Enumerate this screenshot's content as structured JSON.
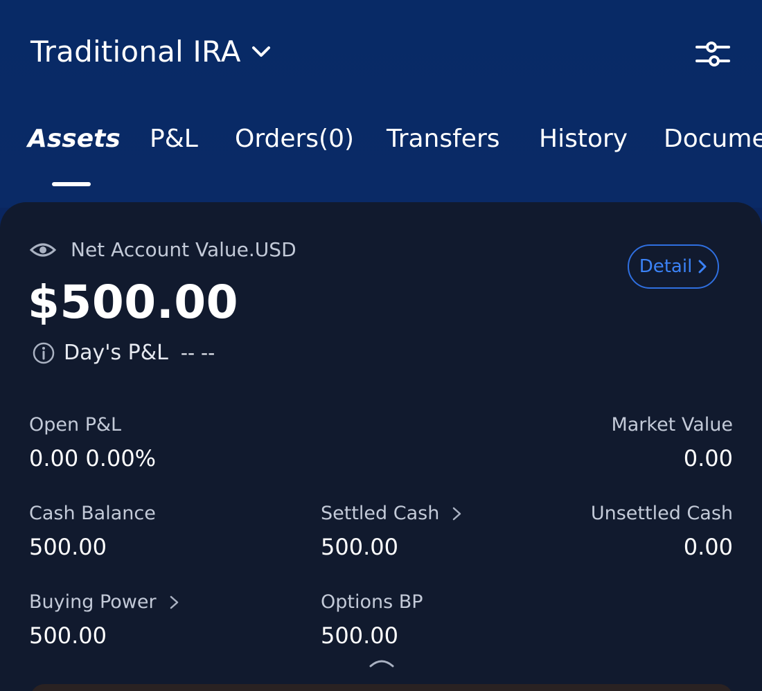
{
  "header": {
    "account_title": "Traditional IRA",
    "accent": "#0a2a66"
  },
  "tabs": [
    {
      "label": "Assets",
      "active": true
    },
    {
      "label": "P&L",
      "active": false
    },
    {
      "label": "Orders(0)",
      "active": false
    },
    {
      "label": "Transfers",
      "active": false
    },
    {
      "label": "History",
      "active": false
    },
    {
      "label": "Docume",
      "active": false
    }
  ],
  "summary": {
    "nav_label": "Net Account Value.USD",
    "nav_value": "$500.00",
    "detail_label": "Detail",
    "days_pl_label": "Day's P&L",
    "days_pl_value": "-- --"
  },
  "metrics": {
    "open_pl": {
      "label": "Open P&L",
      "value": "0.00 0.00%"
    },
    "market_value": {
      "label": "Market Value",
      "value": "0.00"
    },
    "cash_balance": {
      "label": "Cash Balance",
      "value": "500.00"
    },
    "settled_cash": {
      "label": "Settled Cash",
      "value": "500.00"
    },
    "unsettled_cash": {
      "label": "Unsettled Cash",
      "value": "0.00"
    },
    "buying_power": {
      "label": "Buying Power",
      "value": "500.00"
    },
    "options_bp": {
      "label": "Options BP",
      "value": "500.00"
    }
  },
  "colors": {
    "header_bg": "#0a2a66",
    "card_bg": "#111a2e",
    "detail_border": "#2f6fe0"
  }
}
